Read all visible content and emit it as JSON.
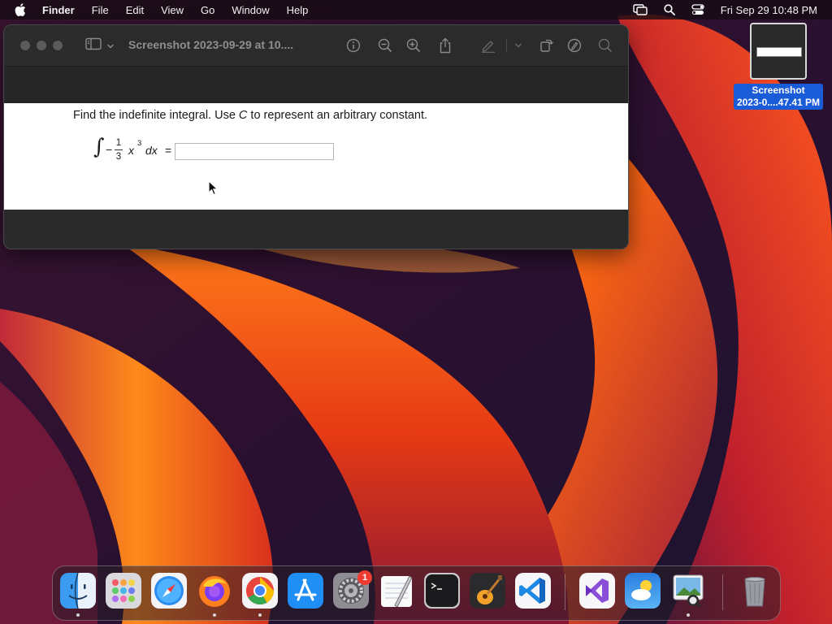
{
  "menubar": {
    "app_name": "Finder",
    "items": [
      "File",
      "Edit",
      "View",
      "Go",
      "Window",
      "Help"
    ],
    "clock": "Fri Sep 29  10:48 PM",
    "icons": [
      "apple-icon",
      "screen-mirroring-icon",
      "spotlight-icon",
      "control-center-icon"
    ]
  },
  "window": {
    "title": "Screenshot 2023-09-29 at 10....",
    "toolbar_icons": [
      "sidebar-icon",
      "chevron-down-icon",
      "info-icon",
      "zoom-out-icon",
      "zoom-in-icon",
      "share-icon",
      "markup-pen-icon",
      "chevron-down-icon",
      "rotate-icon",
      "markup-icon",
      "search-icon"
    ],
    "document": {
      "question_prefix": "Find the indefinite integral. Use ",
      "question_var": "C",
      "question_suffix": " to represent an arbitrary constant.",
      "math": {
        "integral": "∫",
        "minus": "−",
        "numerator": "1",
        "denominator": "3",
        "variable": "x",
        "exponent": "3",
        "differential": "dx",
        "equals": "="
      },
      "answer_value": ""
    }
  },
  "desktop_file": {
    "label_line1": "Screenshot",
    "label_line2": "2023-0....47.41 PM"
  },
  "dock": {
    "apps": [
      {
        "name": "Finder",
        "icon": "finder-icon",
        "running": true
      },
      {
        "name": "Launchpad",
        "icon": "launchpad-icon",
        "running": false
      },
      {
        "name": "Safari",
        "icon": "safari-icon",
        "running": false
      },
      {
        "name": "Firefox",
        "icon": "firefox-icon",
        "running": true
      },
      {
        "name": "Chrome",
        "icon": "chrome-icon",
        "running": true
      },
      {
        "name": "App Store",
        "icon": "app-store-icon",
        "running": false
      },
      {
        "name": "System Settings",
        "icon": "system-settings-icon",
        "running": false,
        "badge": "1"
      },
      {
        "name": "TextEdit",
        "icon": "textedit-icon",
        "running": false
      },
      {
        "name": "Terminal",
        "icon": "terminal-icon",
        "running": false
      },
      {
        "name": "GarageBand",
        "icon": "garageband-icon",
        "running": false
      },
      {
        "name": "Visual Studio Code",
        "icon": "vscode-icon",
        "running": false
      },
      {
        "name": "Visual Studio",
        "icon": "visual-studio-icon",
        "running": false
      },
      {
        "name": "Weather",
        "icon": "weather-icon",
        "running": false
      },
      {
        "name": "Preview",
        "icon": "preview-icon",
        "running": true
      },
      {
        "name": "Trash",
        "icon": "trash-icon",
        "running": false
      }
    ]
  },
  "colors": {
    "menubar_bg": "#140c12",
    "window_bg": "#2a2a2b",
    "selection_blue": "#1a5bd8",
    "badge_red": "#f03b30"
  }
}
